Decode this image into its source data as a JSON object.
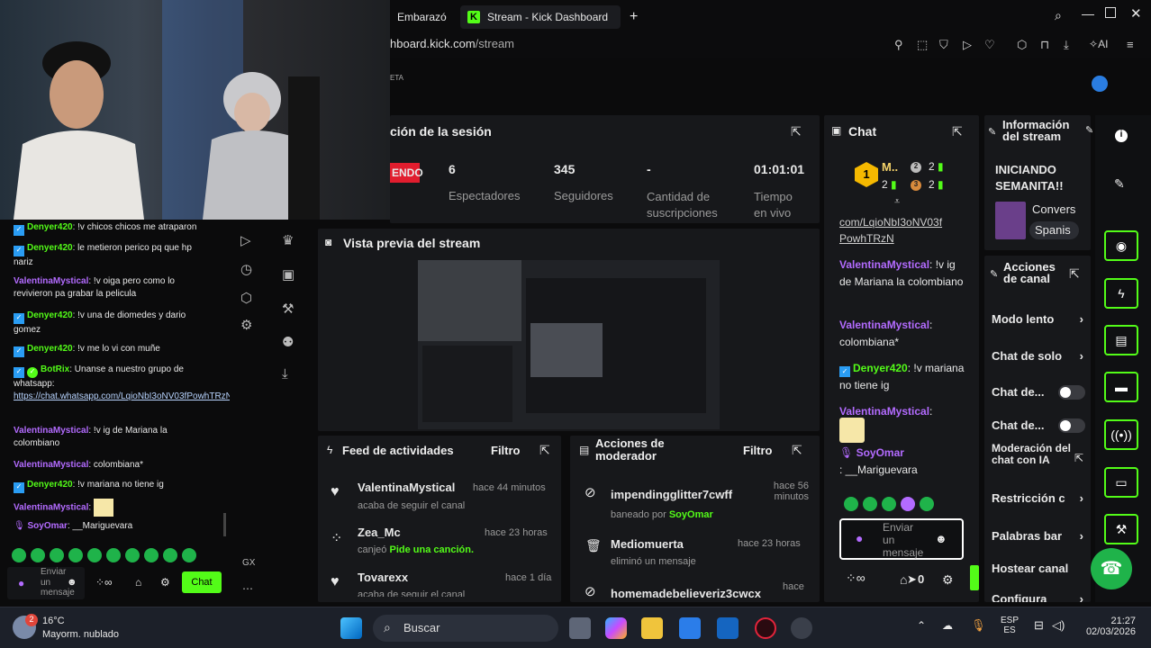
{
  "browser": {
    "tab_prev": "Embarazó",
    "tab_active": "Stream - Kick Dashboard",
    "url_host": "hboard.kick.com",
    "url_path": "/stream",
    "ai_label": "AI"
  },
  "session": {
    "title": "ción de la sesión",
    "live_badge": "ENDO",
    "stats": [
      {
        "value": "6",
        "label": "Espectadores"
      },
      {
        "value": "345",
        "label": "Seguidores"
      },
      {
        "value": "-",
        "label": "Cantidad de suscripciones"
      },
      {
        "value": "01:01:01",
        "label": "Tiempo en vivo"
      }
    ]
  },
  "preview": {
    "title": "Vista previa del stream"
  },
  "activity": {
    "title": "Feed de actividades",
    "filter": "Filtro",
    "items": [
      {
        "user": "ValentinaMystical",
        "time": "hace 44 minutos",
        "detail": "acaba de seguir el canal"
      },
      {
        "user": "Zea_Mc",
        "time": "hace 23 horas",
        "detail_prefix": "canjeó ",
        "detail_highlight": "Pide una canción."
      },
      {
        "user": "Tovarexx",
        "time": "hace 1 día",
        "detail": "acaba de seguir el canal"
      }
    ]
  },
  "mod_actions": {
    "title": "Acciones de moderador",
    "filter": "Filtro",
    "items": [
      {
        "user": "impendingglitter7cwff",
        "time": "hace 56 minutos",
        "detail_prefix": "baneado por ",
        "detail_highlight": "SoyOmar"
      },
      {
        "user": "Mediomuerta",
        "time": "hace 23 horas",
        "detail": "eliminó un mensaje"
      },
      {
        "user": "homemadebelieveriz3cwcx",
        "time": "hace"
      }
    ]
  },
  "chat": {
    "title": "Chat",
    "top_user": "M..",
    "top_count_a": "2",
    "top_count_b": "2",
    "top_count_c": "2",
    "top_count_d": "2",
    "messages": [
      {
        "user": "",
        "text": "com/LqioNbI3oNV03f PowhTRzN"
      },
      {
        "user": "ValentinaMystical",
        "text": ": !v ig de Mariana la colombiano"
      },
      {
        "user": "ValentinaMystical",
        "text": ": colombiana*"
      },
      {
        "user": "Denyer420",
        "text": ": !v mariana no tiene ig"
      },
      {
        "user": "ValentinaMystical",
        "text": ":"
      },
      {
        "user": "SoyOmar",
        "text": ": __Mariguevara"
      }
    ],
    "input_placeholder": "Enviar un mensaje",
    "count": "0"
  },
  "stream_info": {
    "title": "Información del stream",
    "stream_title": "INICIANDO SEMANITA!!",
    "category": "Convers",
    "language": "Spanis"
  },
  "channel_actions": {
    "title": "Acciones de canal",
    "items": [
      {
        "label": "Modo lento",
        "type": "arrow"
      },
      {
        "label": "Chat de solo",
        "type": "arrow"
      },
      {
        "label": "Chat de...",
        "type": "toggle"
      },
      {
        "label": "Chat de...",
        "type": "toggle"
      },
      {
        "label": "Moderación del chat con IA",
        "type": "external"
      },
      {
        "label": "Restricción c",
        "type": "arrow"
      },
      {
        "label": "Palabras bar",
        "type": "arrow"
      },
      {
        "label": "Hostear canal",
        "type": "none"
      },
      {
        "label": "Configura",
        "type": "arrow"
      }
    ]
  },
  "left_chat": {
    "messages": [
      {
        "user": "Denyer420",
        "color": "blue",
        "text": ": !v chicos chicos me atraparon"
      },
      {
        "user": "Denyer420",
        "color": "blue",
        "text": ": le metieron perico pq que hp nariz"
      },
      {
        "user": "ValentinaMystical",
        "color": "purple",
        "text": ": !v oiga pero como lo revivieron pa grabar la pelicula"
      },
      {
        "user": "Denyer420",
        "color": "blue",
        "text": ": !v una de diomedes y dario gomez"
      },
      {
        "user": "Denyer420",
        "color": "blue",
        "text": ": !v me lo vi con muñe"
      },
      {
        "user": "BotRix",
        "color": "blue",
        "text": ": Unanse a nuestro grupo de whatsapp:"
      },
      {
        "user": "",
        "color": "link",
        "text": "https://chat.whatsapp.com/LqioNbI3oNV03fPowhTRzN"
      },
      {
        "user": "ValentinaMystical",
        "color": "purple",
        "text": ": !v ig de Mariana la colombiano"
      },
      {
        "user": "ValentinaMystical",
        "color": "purple",
        "text": ": colombiana*"
      },
      {
        "user": "Denyer420",
        "color": "blue",
        "text": ": !v mariana no tiene ig"
      },
      {
        "user": "ValentinaMystical",
        "color": "purple",
        "text": ":"
      },
      {
        "user": "SoyOmar",
        "color": "purple",
        "text": ": __Mariguevara"
      }
    ],
    "input_placeholder": "Enviar un mensaje",
    "chat_button": "Chat",
    "gx": "GX"
  },
  "taskbar": {
    "temp": "16°C",
    "weather": "Mayorm. nublado",
    "weather_badge": "2",
    "search": "Buscar",
    "lang_top": "ESP",
    "lang_bottom": "ES",
    "time": "21:27",
    "date": "02/03/2026"
  }
}
